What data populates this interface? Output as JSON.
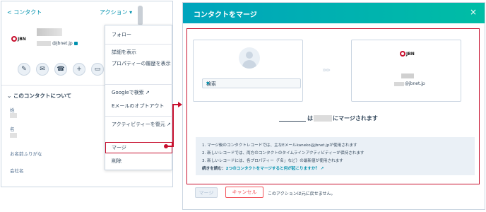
{
  "contact_panel": {
    "back_label": "< コンタクト",
    "actions_label": "アクション ▾",
    "company_logo_text": "JBN",
    "email_suffix": "@jbnet.jp",
    "about_section": "このコンタクトについて",
    "properties": [
      {
        "label": "姓"
      },
      {
        "label": "名"
      },
      {
        "label": "お名前ふりがな"
      },
      {
        "label": "会社名"
      }
    ],
    "action_buttons": [
      "✎",
      "✉",
      "☎",
      "+",
      "▭"
    ]
  },
  "action_menu": {
    "items": [
      "フォロー",
      "詳細を表示",
      "プロパティーの履歴を表示",
      "Googleで検索",
      "Eメールのオプトアウト",
      "アクティビティーを復元",
      "マージ",
      "削除"
    ]
  },
  "merge_modal": {
    "title": "コンタクトをマージ",
    "close_icon": "×",
    "search_placeholder": "検索",
    "right_logo_text": "JBN",
    "right_email_suffix": "@jbnet.jp",
    "merged_into_prefix": "は",
    "merged_into_suffix": "にマージされます",
    "notes": [
      "1. マージ後のコンタクトレコードでは、主なEメールkaneko@jbnet.jpが使用されます",
      "2. 新しいレコードでは、両方のコンタクトのタイムラインアクティビティーが保持されます",
      "3. 新しいレコードには、各プロパティー（「名」など）の最新値が使用されます"
    ],
    "read_more_prefix": "続きを読む：",
    "read_more_link": "2つのコンタクトをマージすると何が起こりますか？",
    "merge_button": "マージ",
    "cancel_button": "キャンセル",
    "irreversible_note": "このアクションは元に戻せません。"
  },
  "colors": {
    "accent": "#0091ae",
    "header_gradient_start": "#00a4bd",
    "header_gradient_end": "#00bda5",
    "highlight": "#c8102e",
    "cancel": "#f2545b"
  }
}
